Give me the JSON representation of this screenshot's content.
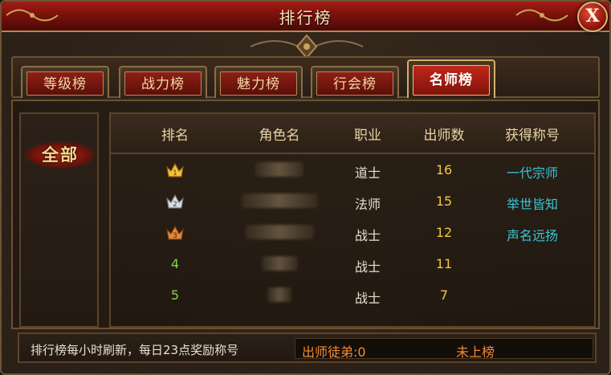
{
  "window": {
    "title": "排行榜",
    "close_label": "X"
  },
  "tabs": [
    {
      "label": "等级榜",
      "active": false
    },
    {
      "label": "战力榜",
      "active": false
    },
    {
      "label": "魅力榜",
      "active": false
    },
    {
      "label": "行会榜",
      "active": false
    },
    {
      "label": "名师榜",
      "active": true
    }
  ],
  "sidebar": {
    "category_all": "全部"
  },
  "table": {
    "headers": [
      "排名",
      "角色名",
      "职业",
      "出师数",
      "获得称号"
    ],
    "rows": [
      {
        "rank": "1",
        "rank_icon": "gold-crown-icon",
        "name": "",
        "job": "道士",
        "count": "16",
        "title": "一代宗师"
      },
      {
        "rank": "2",
        "rank_icon": "silver-crown-icon",
        "name": "",
        "job": "法师",
        "count": "15",
        "title": "举世皆知"
      },
      {
        "rank": "3",
        "rank_icon": "bronze-crown-icon",
        "name": "",
        "job": "战士",
        "count": "12",
        "title": "声名远扬"
      },
      {
        "rank": "4",
        "rank_icon": "",
        "name": "",
        "job": "战士",
        "count": "11",
        "title": ""
      },
      {
        "rank": "5",
        "rank_icon": "",
        "name": "",
        "job": "战士",
        "count": "7",
        "title": ""
      }
    ]
  },
  "footer": {
    "note": "排行榜每小时刷新，每日23点奖励称号",
    "my_count_label": "出师徒弟:0",
    "my_rank_status": "未上榜"
  },
  "colors": {
    "title_bar": "#8f1810",
    "rank_number": "#7ed84a",
    "count": "#f4c542",
    "title_text": "#39c5d8",
    "footer_status": "#f08a34"
  }
}
